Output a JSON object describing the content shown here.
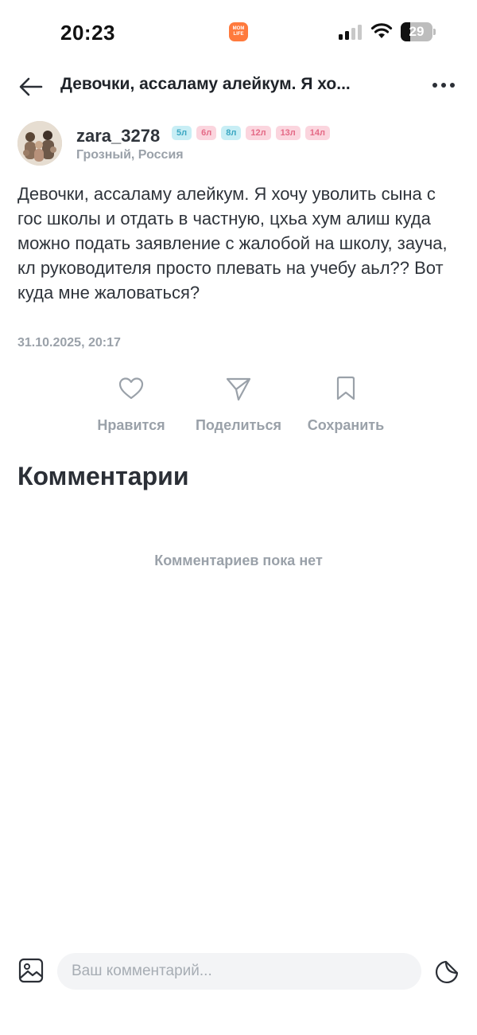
{
  "status_bar": {
    "time": "20:23",
    "app_badge_line1": "MOM",
    "app_badge_line2": "LIFE",
    "battery_level": "29",
    "battery_fraction": 0.29
  },
  "header": {
    "title": "Девочки, ассаламу алейкум. Я хо...",
    "back_icon": "back-arrow-icon",
    "more_icon": "more-horizontal-icon"
  },
  "author": {
    "name": "zara_3278",
    "location": "Грозный, Россия",
    "tags": [
      {
        "label": "5л",
        "color": "#3aa7c2"
      },
      {
        "label": "6л",
        "color": "#e46a86"
      },
      {
        "label": "8л",
        "color": "#3aa7c2"
      },
      {
        "label": "12л",
        "color": "#e46a86"
      },
      {
        "label": "13л",
        "color": "#e46a86"
      },
      {
        "label": "14л",
        "color": "#e46a86"
      }
    ]
  },
  "post": {
    "text": "Девочки, ассаламу алейкум. Я хочу уволить сына с гос школы и отдать в частную, цхьа хум алиш куда можно подать заявление с жалобой на школу, зауча, кл руководителя просто плевать на учебу аьл?? Вот куда мне жаловаться?",
    "date": "31.10.2025, 20:17"
  },
  "actions": {
    "like_label": "Нравится",
    "share_label": "Поделиться",
    "save_label": "Сохранить"
  },
  "comments": {
    "title": "Комментарии",
    "empty_text": "Комментариев пока нет"
  },
  "composer": {
    "placeholder": "Ваш комментарий..."
  },
  "colors": {
    "accent_orange": "#ff7a3d",
    "muted_text": "#9aa1a9",
    "primary_text": "#2b2f36"
  }
}
